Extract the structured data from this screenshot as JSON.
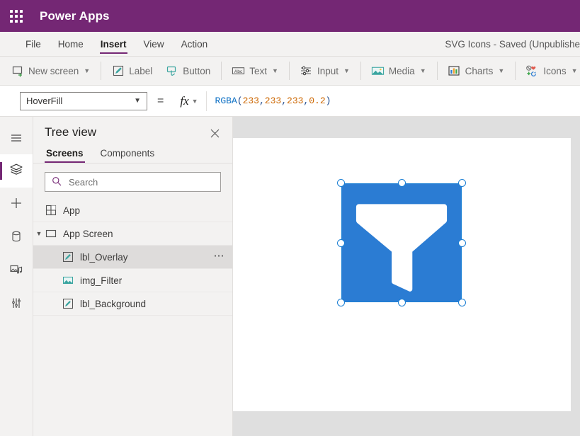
{
  "brand": {
    "waffle_icon": "app-launcher-waffle-icon",
    "product_name": "Power Apps"
  },
  "menubar": {
    "items": [
      {
        "label": "File",
        "active": false
      },
      {
        "label": "Home",
        "active": false
      },
      {
        "label": "Insert",
        "active": true
      },
      {
        "label": "View",
        "active": false
      },
      {
        "label": "Action",
        "active": false
      }
    ],
    "app_status": "SVG Icons - Saved (Unpublishe"
  },
  "ribbon": {
    "groups": [
      {
        "buttons": [
          {
            "label": "New screen",
            "icon": "new-screen-icon",
            "caret": true
          }
        ]
      },
      {
        "buttons": [
          {
            "label": "Label",
            "icon": "label-icon",
            "caret": false
          },
          {
            "label": "Button",
            "icon": "button-icon",
            "caret": false
          }
        ]
      },
      {
        "buttons": [
          {
            "label": "Text",
            "icon": "text-abc-icon",
            "caret": true
          }
        ]
      },
      {
        "buttons": [
          {
            "label": "Input",
            "icon": "input-sliders-icon",
            "caret": true
          }
        ]
      },
      {
        "buttons": [
          {
            "label": "Media",
            "icon": "media-image-icon",
            "caret": true
          }
        ]
      },
      {
        "buttons": [
          {
            "label": "Charts",
            "icon": "charts-bar-icon",
            "caret": true
          }
        ]
      },
      {
        "buttons": [
          {
            "label": "Icons",
            "icon": "icons-collection-icon",
            "caret": true
          }
        ]
      }
    ]
  },
  "formula_bar": {
    "property_selected": "HoverFill",
    "equals": "=",
    "fx_label": "fx",
    "formula_text": "RGBA(233,233,233,0.2)",
    "formula_tokens": [
      {
        "text": "RGBA",
        "type": "fn"
      },
      {
        "text": "(",
        "type": "punct"
      },
      {
        "text": "233",
        "type": "num"
      },
      {
        "text": ",",
        "type": "punct"
      },
      {
        "text": "233",
        "type": "num"
      },
      {
        "text": ",",
        "type": "punct"
      },
      {
        "text": "233",
        "type": "num"
      },
      {
        "text": ",",
        "type": "punct"
      },
      {
        "text": "0.2",
        "type": "num"
      },
      {
        "text": ")",
        "type": "punct"
      }
    ]
  },
  "rail": {
    "items": [
      {
        "name": "hamburger-menu-icon",
        "active": false
      },
      {
        "name": "tree-view-layers-icon",
        "active": true
      },
      {
        "name": "insert-plus-icon",
        "active": false
      },
      {
        "name": "data-database-icon",
        "active": false
      },
      {
        "name": "media-library-icon",
        "active": false
      },
      {
        "name": "advanced-tools-icon",
        "active": false
      }
    ]
  },
  "tree_view": {
    "title": "Tree view",
    "close_icon": "close-icon",
    "tabs": [
      {
        "label": "Screens",
        "active": true
      },
      {
        "label": "Components",
        "active": false
      }
    ],
    "search": {
      "placeholder": "Search",
      "value": "",
      "icon": "search-icon"
    },
    "nodes": [
      {
        "label": "App",
        "icon": "app-icon",
        "indent": 0,
        "twisty": "",
        "selected": false,
        "overflow": false
      },
      {
        "label": "App Screen",
        "icon": "screen-icon",
        "indent": 1,
        "twisty": "v",
        "selected": false,
        "overflow": false
      },
      {
        "label": "lbl_Overlay",
        "icon": "label-icon",
        "indent": 2,
        "twisty": "",
        "selected": true,
        "overflow": true,
        "overflow_label": "⋯"
      },
      {
        "label": "img_Filter",
        "icon": "image-icon",
        "indent": 2,
        "twisty": "",
        "selected": false,
        "overflow": false
      },
      {
        "label": "lbl_Background",
        "icon": "label-icon",
        "indent": 2,
        "twisty": "",
        "selected": false,
        "overflow": false
      }
    ]
  },
  "canvas": {
    "background_color": "#dfdfdf",
    "screen_color": "#ffffff",
    "selected_control": "img_Filter",
    "image": {
      "name": "filter-funnel-svg",
      "fill_color": "#2b7cd3",
      "glyph_color": "#ffffff"
    },
    "selection": {
      "accent_color": "#1b7fd4",
      "handles": [
        "nw",
        "n",
        "ne",
        "w",
        "e",
        "sw",
        "s",
        "se"
      ]
    }
  },
  "colors": {
    "brand_purple": "#742774",
    "chrome_gray": "#f3f2f1",
    "accent_blue": "#2b7cd3"
  }
}
